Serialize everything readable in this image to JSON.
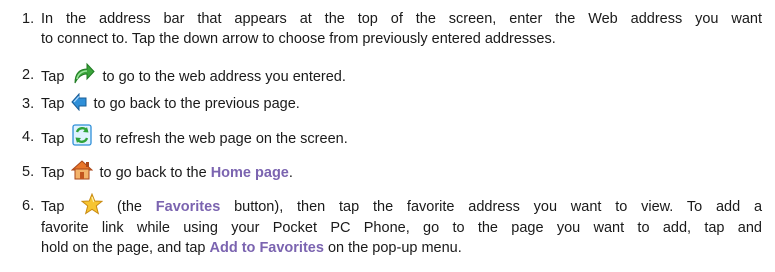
{
  "steps": [
    {
      "number": "1.",
      "line1": "In the address bar that appears at the top of the screen, enter the Web address you want",
      "line2": "to connect to. Tap the down arrow to choose from previously entered addresses."
    },
    {
      "number": "2.",
      "pre": "Tap",
      "icon": "go-arrow-icon",
      "post": "to go to the web address you entered."
    },
    {
      "number": "3.",
      "pre": "Tap",
      "icon": "back-arrow-icon",
      "post": "to go back to the previous page."
    },
    {
      "number": "4.",
      "pre": "Tap",
      "icon": "refresh-icon",
      "post": "to refresh the web page on the screen."
    },
    {
      "number": "5.",
      "pre": "Tap",
      "icon": "home-icon",
      "post": "to go back to the",
      "keyword": "Home page",
      "end": "."
    },
    {
      "number": "6.",
      "pre": "Tap",
      "icon": "favorites-star-icon",
      "mid1": "(the",
      "keyword1": "Favorites",
      "mid2": "button), then tap the favorite address you want to view. To add a",
      "line2": "favorite link while using your Pocket PC Phone, go to the page you want to add, tap and",
      "line3_pre": "hold on the page, and tap",
      "keyword2": "Add to Favorites",
      "line3_post": "on the pop-up menu."
    }
  ],
  "colors": {
    "text": "#1a1a1a",
    "keyword": "#7b64b0",
    "icon_green": "#3aa43a",
    "icon_blue": "#2f8fd8",
    "icon_orange": "#e8762a"
  }
}
